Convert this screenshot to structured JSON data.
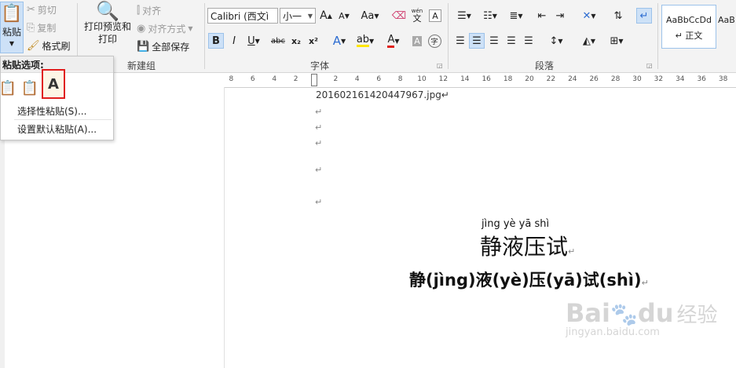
{
  "clipboard": {
    "paste_label": "粘贴",
    "cut_label": "剪切",
    "copy_label": "复制",
    "format_painter_label": "格式刷"
  },
  "newgroup": {
    "print_preview_label": "打印预览和打印",
    "align_label": "对齐",
    "align_mode_label": "对齐方式",
    "save_all_label": "全部保存",
    "group_label": "新建组"
  },
  "font": {
    "font_name": "Calibri (西文ì",
    "font_size": "小一",
    "group_label": "字体",
    "wen_glyph": "wén",
    "wen_char": "文",
    "bold": "B",
    "italic": "I",
    "underline": "U",
    "strikethrough": "abc",
    "subscript": "x₂",
    "superscript": "x²",
    "case_label": "Aa",
    "grow_font": "A",
    "shrink_font": "A",
    "char_border": "A",
    "font_color_letter": "A",
    "char_shading": "A",
    "enclose_char": "字",
    "text_effect": "A"
  },
  "paragraph": {
    "group_label": "段落"
  },
  "styles": {
    "style1_sample": "AaBbCcDd",
    "style1_name": "↵ 正文",
    "style2_sample": "AaB"
  },
  "paste_options": {
    "header": "粘贴选项:",
    "selective_paste": "选择性粘贴(S)...",
    "default_paste": "设置默认粘贴(A)..."
  },
  "ruler": {
    "ticks": [
      "8",
      "6",
      "4",
      "2",
      "2",
      "4",
      "6",
      "8",
      "10",
      "12",
      "14",
      "16",
      "18",
      "20",
      "22",
      "24",
      "26",
      "28",
      "30",
      "32",
      "34",
      "36",
      "38"
    ]
  },
  "document": {
    "filename_line": "20160216142044796​7.jpg↵",
    "para_mark": "↵",
    "pinyin_ruby": "jìng yè yā shì",
    "title_chars": "静液压试",
    "pinyin_line": "静(jìng)液(yè)压(yā)试(shì)"
  },
  "watermark": {
    "brand": "Bai",
    "brand2": "du",
    "brand_cn": "经验",
    "url": "jingyan.baidu.com"
  }
}
